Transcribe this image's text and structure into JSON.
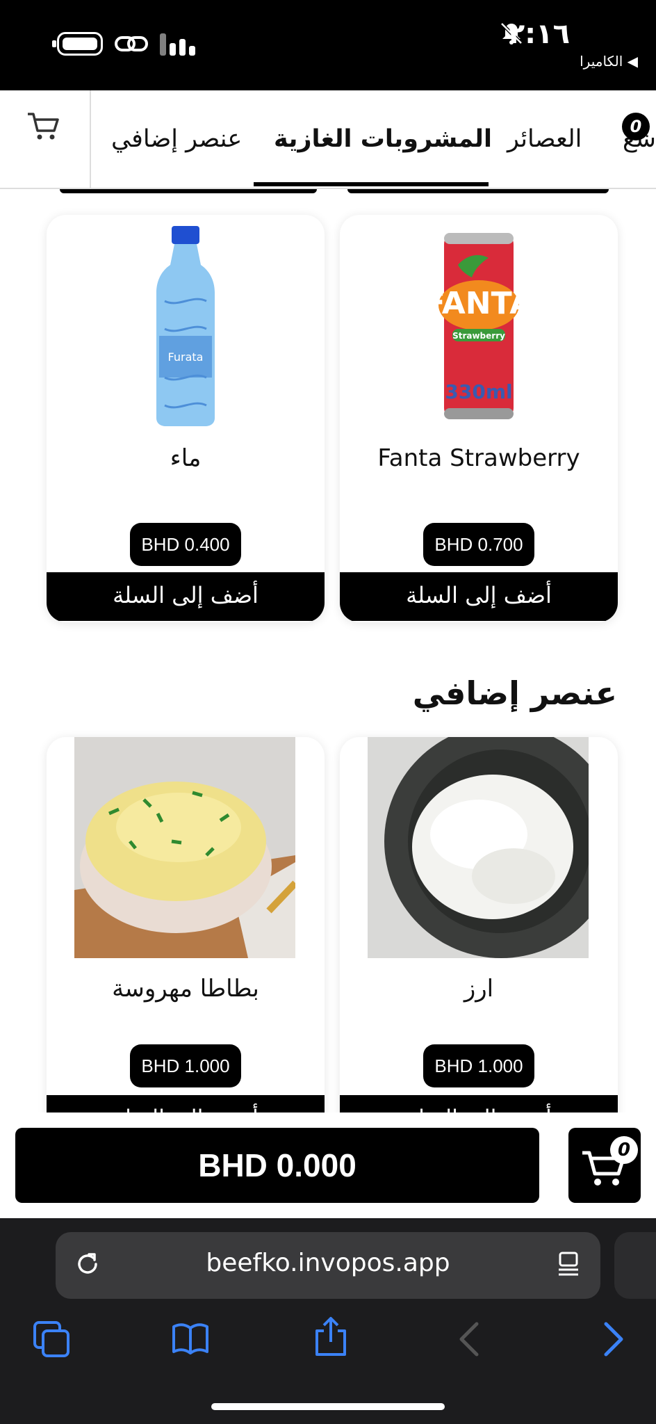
{
  "status_bar": {
    "time": "٢:١٦",
    "back_label": "◀ الكاميرا"
  },
  "tabs": {
    "items": [
      {
        "label": "عنصر إضافي"
      },
      {
        "label": "المشروبات الغازية"
      },
      {
        "label": "العصائر"
      },
      {
        "label": "شع"
      }
    ],
    "badge": "0"
  },
  "drinks": [
    {
      "name": "Fanta Strawberry",
      "price": "BHD 0.700",
      "add_label": "أضف إلى السلة",
      "can_brand": "FANTA",
      "can_flavor": "Strawberry",
      "can_volume": "330ml"
    },
    {
      "name": "ماء",
      "price": "BHD 0.400",
      "add_label": "أضف إلى السلة",
      "bottle_brand": "Furata"
    }
  ],
  "extras": {
    "title": "عنصر إضافي",
    "items": [
      {
        "name": "ارز",
        "price": "BHD 1.000",
        "add_label": "أضف إلى السلة"
      },
      {
        "name": "بطاطا مهروسة",
        "price": "BHD 1.000",
        "add_label": "أضف إلى السلة"
      }
    ]
  },
  "order": {
    "total": "BHD 0.000",
    "cart_count": "0"
  },
  "browser": {
    "url": "beefko.invopos.app"
  },
  "colors": {
    "accent": "#000000",
    "browser_bg": "#1c1c1e",
    "browser_icon": "#3b82f6"
  }
}
